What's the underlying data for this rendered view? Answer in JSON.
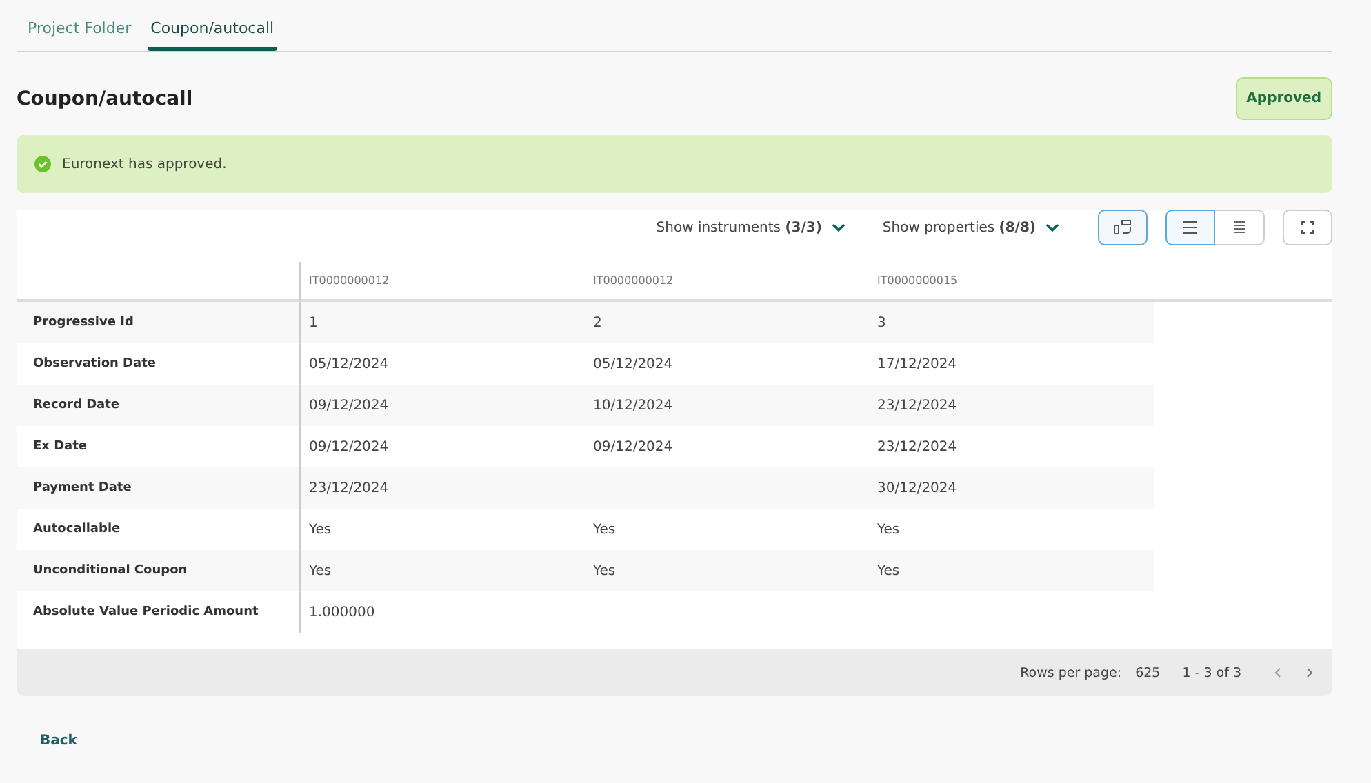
{
  "tabs": [
    {
      "label": "Project Folder",
      "selected": false
    },
    {
      "label": "Coupon/autocall",
      "selected": true
    }
  ],
  "title": "Coupon/autocall",
  "status_badge": "Approved",
  "alert": {
    "kind": "success",
    "message": "Euronext has approved."
  },
  "toolbar": {
    "filters": [
      {
        "label": "Show instruments",
        "count": "(3/3)"
      },
      {
        "label": "Show properties",
        "count": "(8/8)"
      }
    ],
    "transpose_on": true,
    "view_modes": [
      {
        "kind": "comfortable",
        "selected": true
      },
      {
        "kind": "compact",
        "selected": false
      }
    ]
  },
  "table": {
    "columns": [
      "IT0000000012",
      "IT0000000012",
      "IT0000000015"
    ],
    "rows": [
      {
        "label": "Progressive Id",
        "cells": [
          "1",
          "2",
          "3"
        ]
      },
      {
        "label": "Observation Date",
        "cells": [
          "05/12/2024",
          "05/12/2024",
          "17/12/2024"
        ]
      },
      {
        "label": "Record Date",
        "cells": [
          "09/12/2024",
          "10/12/2024",
          "23/12/2024"
        ]
      },
      {
        "label": "Ex Date",
        "cells": [
          "09/12/2024",
          "09/12/2024",
          "23/12/2024"
        ]
      },
      {
        "label": "Payment Date",
        "cells": [
          "23/12/2024",
          null,
          "30/12/2024"
        ]
      },
      {
        "label": "Autocallable",
        "cells": [
          "Yes",
          "Yes",
          "Yes"
        ]
      },
      {
        "label": "Unconditional Coupon",
        "cells": [
          "Yes",
          "Yes",
          "Yes"
        ]
      },
      {
        "label": "Absolute Value Periodic Amount",
        "cells": [
          "1.000000",
          null,
          null
        ]
      }
    ]
  },
  "pagination": {
    "rows_per_page_label": "Rows per page:",
    "rows_per_page": "625",
    "range": "1 - 3 of 3"
  },
  "back_link": "Back"
}
